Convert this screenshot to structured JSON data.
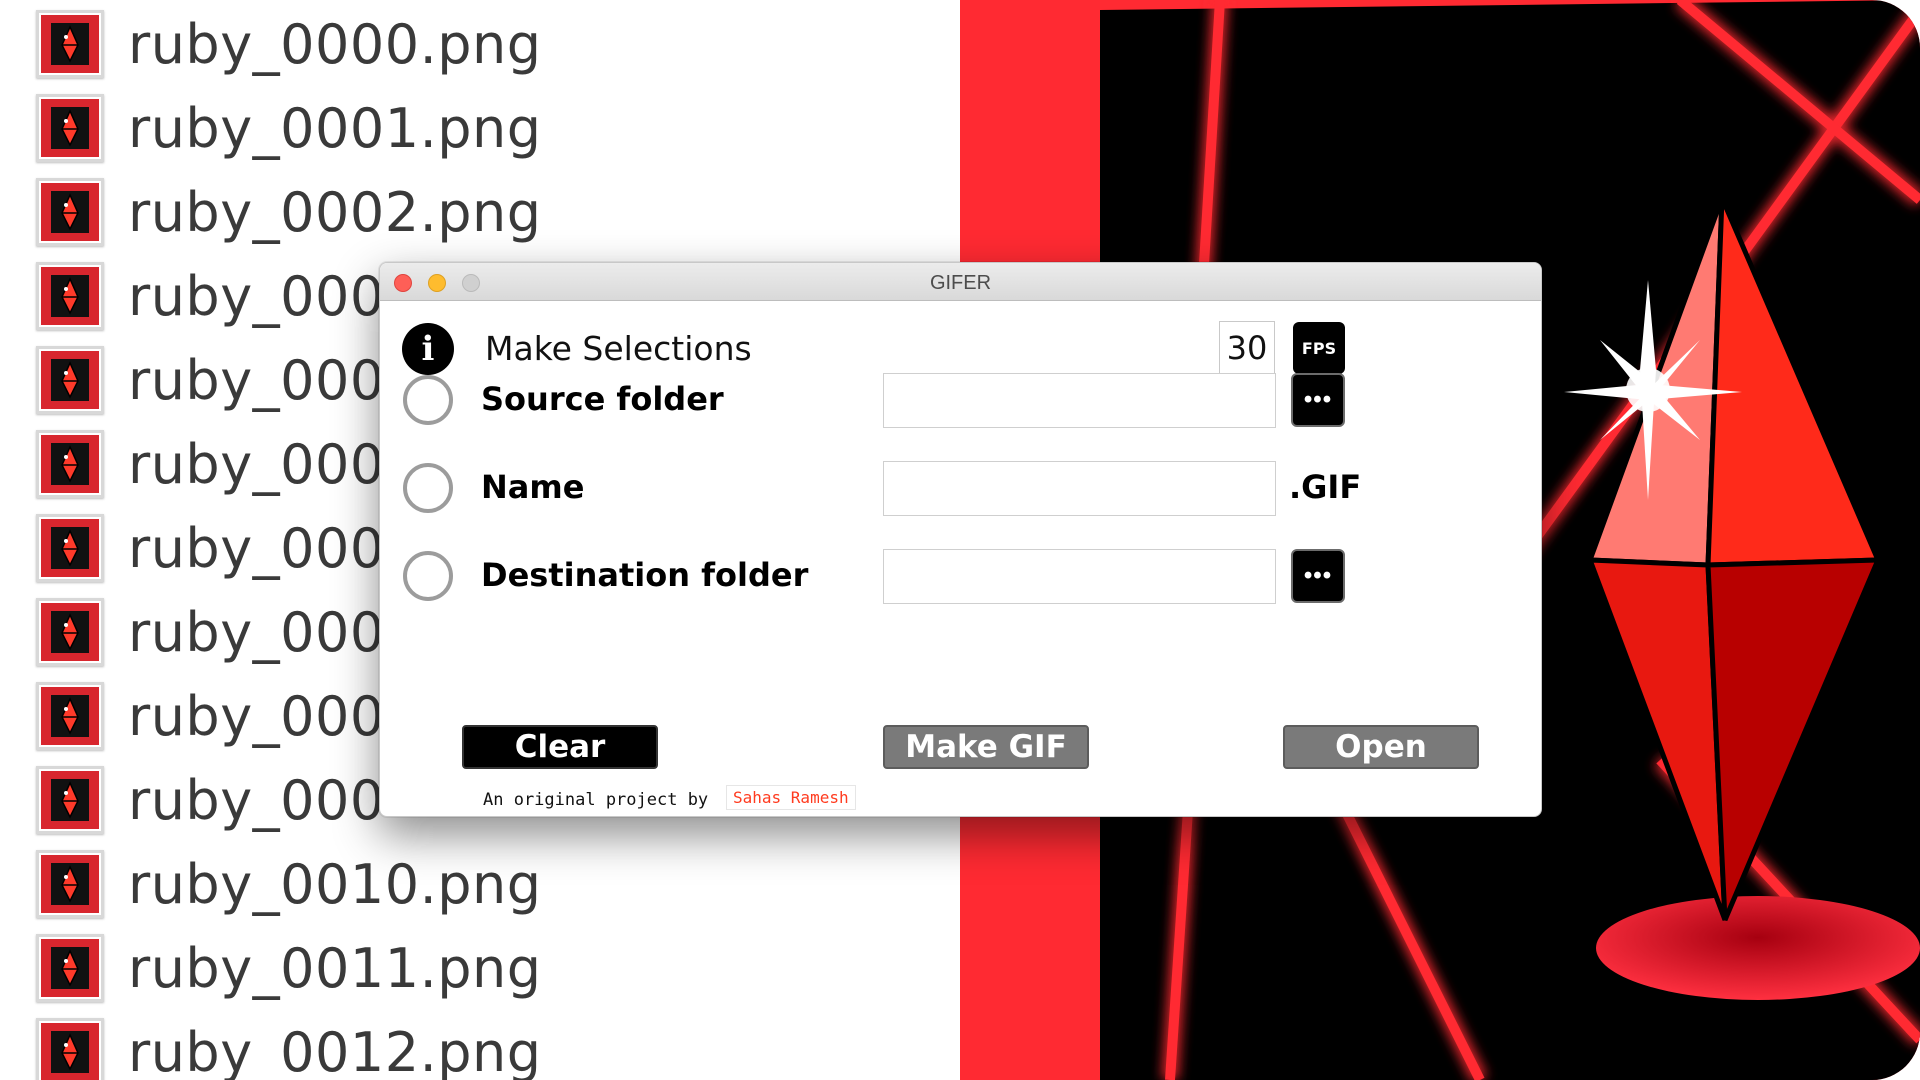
{
  "file_list": {
    "items": [
      {
        "name": "ruby_0000.png"
      },
      {
        "name": "ruby_0001.png"
      },
      {
        "name": "ruby_0002.png"
      },
      {
        "name": "ruby_000"
      },
      {
        "name": "ruby_000"
      },
      {
        "name": "ruby_000"
      },
      {
        "name": "ruby_000"
      },
      {
        "name": "ruby_000"
      },
      {
        "name": "ruby_000"
      },
      {
        "name": "ruby_000"
      },
      {
        "name": "ruby_0010.png"
      },
      {
        "name": "ruby_0011.png"
      },
      {
        "name": "ruby_0012.png"
      }
    ],
    "thumbnail_color": "#d8262e"
  },
  "artwork": {
    "background_color": "#ff2a32",
    "gem_color": "#e00000"
  },
  "window": {
    "title": "GIFER",
    "heading": "Make Selections",
    "info_icon": "i",
    "fps_value": "30",
    "fps_button_label": "FPS",
    "fields": {
      "source": {
        "label": "Source folder",
        "value": "",
        "browse_label": "•••"
      },
      "name": {
        "label": "Name",
        "value": "",
        "suffix": ".GIF"
      },
      "destination": {
        "label": "Destination folder",
        "value": "",
        "browse_label": "•••"
      }
    },
    "buttons": {
      "clear": "Clear",
      "make_gif": "Make GIF",
      "open": "Open"
    },
    "credit_text": "An original project by",
    "credit_link": "Sahas Ramesh"
  }
}
